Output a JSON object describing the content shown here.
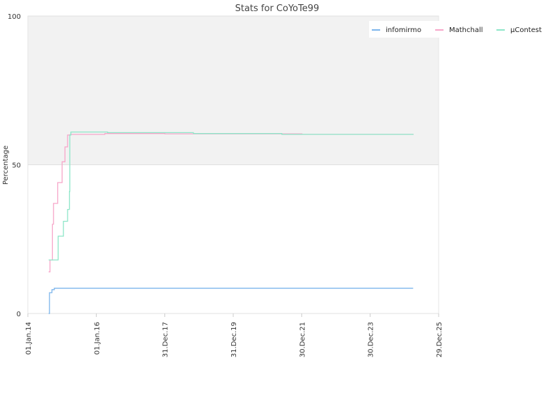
{
  "chart_data": {
    "type": "line",
    "title": "Stats for CoYoTe99",
    "xlabel": "",
    "ylabel": "Percentage",
    "ylim": [
      0,
      100
    ],
    "yticks": [
      0,
      50,
      100
    ],
    "xlim": [
      "2014-01-01",
      "2025-12-29"
    ],
    "xticks": [
      {
        "date": "2014-01-01",
        "label": "01.Jan.14"
      },
      {
        "date": "2016-01-01",
        "label": "01.Jan.16"
      },
      {
        "date": "2017-12-31",
        "label": "31.Dec.17"
      },
      {
        "date": "2019-12-31",
        "label": "31.Dec.19"
      },
      {
        "date": "2021-12-30",
        "label": "30.Dec.21"
      },
      {
        "date": "2023-12-30",
        "label": "30.Dec.23"
      },
      {
        "date": "2025-12-29",
        "label": "29.Dec.25"
      }
    ],
    "grid": true,
    "upper_band": [
      50,
      100
    ],
    "legend_position": "top-right",
    "series": [
      {
        "name": "infomirmo",
        "color": "#7cb5ec",
        "points": [
          [
            "2014-08-10",
            0
          ],
          [
            "2014-08-20",
            7
          ],
          [
            "2014-09-15",
            8
          ],
          [
            "2014-10-10",
            8.5
          ],
          [
            "2015-01-01",
            8.5
          ],
          [
            "2017-01-01",
            8.5
          ],
          [
            "2020-01-01",
            8.5
          ],
          [
            "2022-01-01",
            8.5
          ],
          [
            "2025-04-01",
            8.5
          ]
        ]
      },
      {
        "name": "Mathchall",
        "color": "#f7a6c9",
        "points": [
          [
            "2014-08-10",
            14
          ],
          [
            "2014-08-25",
            18
          ],
          [
            "2014-09-20",
            30
          ],
          [
            "2014-10-01",
            37
          ],
          [
            "2014-11-15",
            44
          ],
          [
            "2015-01-01",
            51
          ],
          [
            "2015-02-01",
            56
          ],
          [
            "2015-03-01",
            60
          ],
          [
            "2015-04-01",
            60.2
          ],
          [
            "2016-04-01",
            60.5
          ],
          [
            "2018-01-01",
            60.4
          ],
          [
            "2022-01-01",
            60.2
          ],
          [
            "2025-04-01",
            60.1
          ]
        ]
      },
      {
        "name": "µContest",
        "color": "#90ed7d",
        "stroke": "#8de6c8",
        "points": [
          [
            "2014-08-10",
            18
          ],
          [
            "2014-10-20",
            18
          ],
          [
            "2014-11-20",
            26
          ],
          [
            "2015-01-15",
            31
          ],
          [
            "2015-03-01",
            35
          ],
          [
            "2015-03-20",
            41
          ],
          [
            "2015-03-25",
            60
          ],
          [
            "2015-04-05",
            61
          ],
          [
            "2016-04-01",
            61
          ],
          [
            "2016-05-01",
            60.8
          ],
          [
            "2018-10-01",
            60.8
          ],
          [
            "2018-11-01",
            60.5
          ],
          [
            "2021-05-01",
            60.5
          ],
          [
            "2021-06-01",
            60.2
          ],
          [
            "2025-04-01",
            60.1
          ]
        ]
      }
    ]
  }
}
